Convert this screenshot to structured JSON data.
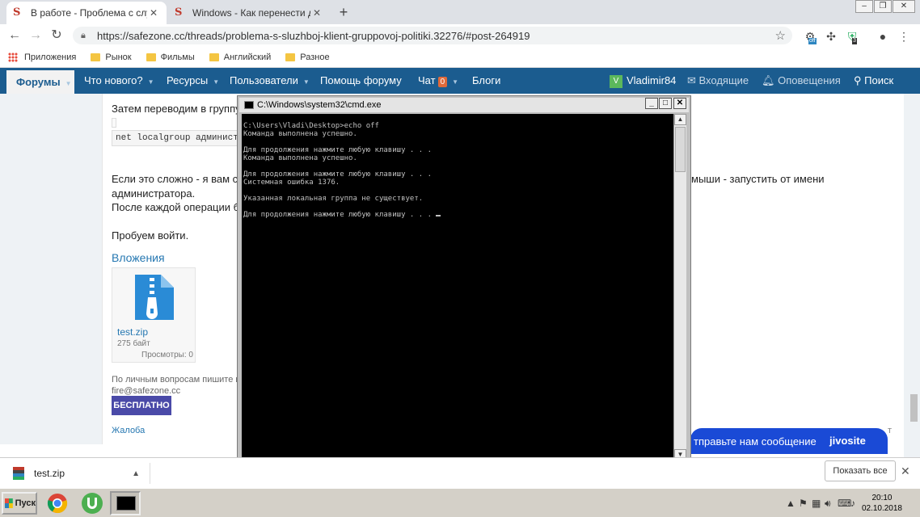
{
  "browser": {
    "tabs": [
      {
        "title": "В работе - Проблема с службой",
        "active": true
      },
      {
        "title": "Windows - Как перенести данны",
        "active": false
      }
    ],
    "new_tab": "+",
    "url": "https://safezone.cc/threads/problema-s-sluzhboj-klient-gruppovoj-politiki.32276/#post-264919",
    "bookmarks": [
      "Приложения",
      "Рынок",
      "Фильмы",
      "Английский",
      "Разное"
    ],
    "extension_badges": {
      "off": "off",
      "count": "3"
    }
  },
  "site_nav": {
    "forums": "Форумы",
    "whats_new": "Что нового?",
    "resources": "Ресурсы",
    "users": "Пользователи",
    "help": "Помощь форуму",
    "chat": "Чат",
    "chat_count": "0",
    "blogs": "Блоги",
    "user_initial": "V",
    "username": "Vladimir84",
    "inbox": "Входящие",
    "alerts": "Оповещения",
    "search": "Поиск"
  },
  "post": {
    "line1": "Затем переводим в группу",
    "code": "net localgroup администраторы",
    "line2_left": "Если это сложно - я вам ск",
    "line2_right": "мыши - запустить от имени",
    "line3": "администратора.",
    "line4": "После каждой операции б",
    "line5": "Пробуем войти.",
    "attachments_heading": "Вложения",
    "attachment": {
      "name": "test.zip",
      "size": "275 байт",
      "views": "Просмотры: 0"
    },
    "sig_line1": "По личным вопросам пишите ко",
    "sig_email": "fire@safezone.cc",
    "free_button": "БЕСПЛАТНО",
    "report": "Жалоба",
    "obscured_right": "т"
  },
  "jivosite": {
    "message": "тправьте нам сообщение",
    "brand": "jivosite"
  },
  "cmd": {
    "title": "C:\\Windows\\system32\\cmd.exe",
    "lines": [
      "C:\\Users\\Vladi\\Desktop>echo off",
      "Команда выполнена успешно.",
      "",
      "Для продолжения нажмите любую клавишу . . .",
      "Команда выполнена успешно.",
      "",
      "Для продолжения нажмите любую клавишу . . .",
      "Системная ошибка 1376.",
      "",
      "Указанная локальная группа не существует.",
      "",
      "Для продолжения нажмите любую клавишу . . ."
    ]
  },
  "downloads": {
    "file": "test.zip",
    "show_all": "Показать все"
  },
  "taskbar": {
    "start": "Пуск",
    "time": "20:10",
    "date": "02.10.2018"
  }
}
